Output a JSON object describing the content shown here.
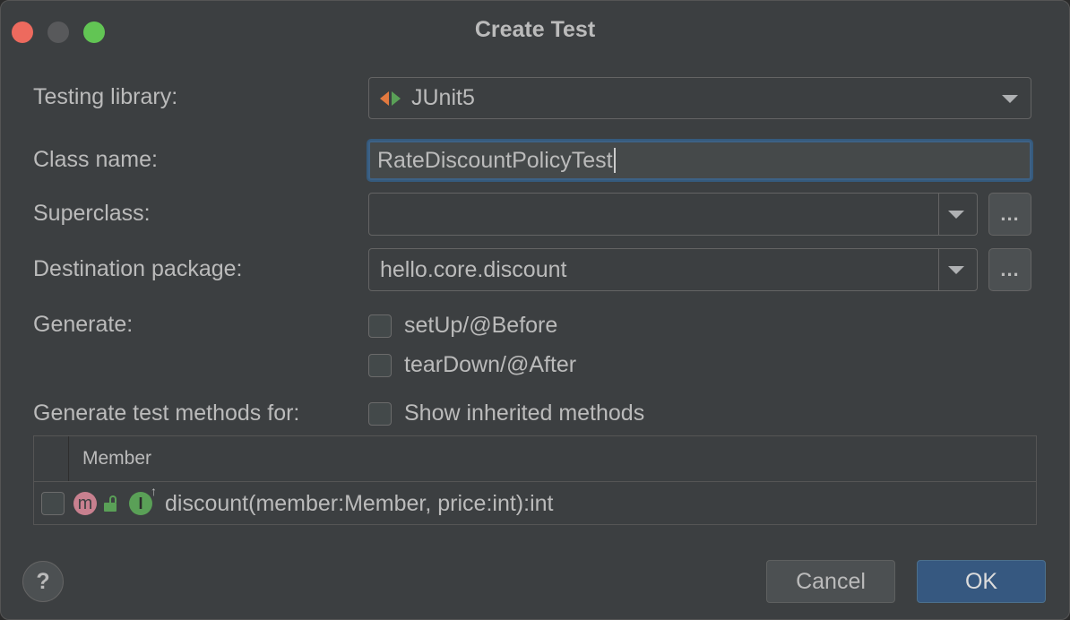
{
  "window": {
    "title": "Create Test"
  },
  "form": {
    "testing_library_label": "Testing library:",
    "testing_library_value": "JUnit5",
    "class_name_label": "Class name:",
    "class_name_value": "RateDiscountPolicyTest",
    "superclass_label": "Superclass:",
    "superclass_value": "",
    "superclass_browse": "...",
    "destination_label": "Destination package:",
    "destination_value": "hello.core.discount",
    "destination_browse": "...",
    "generate_label": "Generate:",
    "setup_label": "setUp/@Before",
    "setup_checked": false,
    "teardown_label": "tearDown/@After",
    "teardown_checked": false,
    "methods_for_label": "Generate test methods for:",
    "show_inherited_label": "Show inherited methods",
    "show_inherited_checked": false
  },
  "table": {
    "column_member": "Member",
    "rows": [
      {
        "checked": false,
        "signature": "discount(member:Member, price:int):int"
      }
    ]
  },
  "buttons": {
    "help": "?",
    "cancel": "Cancel",
    "ok": "OK"
  },
  "icons": {
    "junit": "junit-icon",
    "method_badge": "m",
    "interface_badge": "I",
    "override": "↑"
  },
  "colors": {
    "background": "#3c3f41",
    "accent_ok": "#365880",
    "focus_border": "#3d6185",
    "junit_orange": "#e2793f",
    "junit_green": "#5aa057",
    "method_badge": "#c8808f"
  }
}
